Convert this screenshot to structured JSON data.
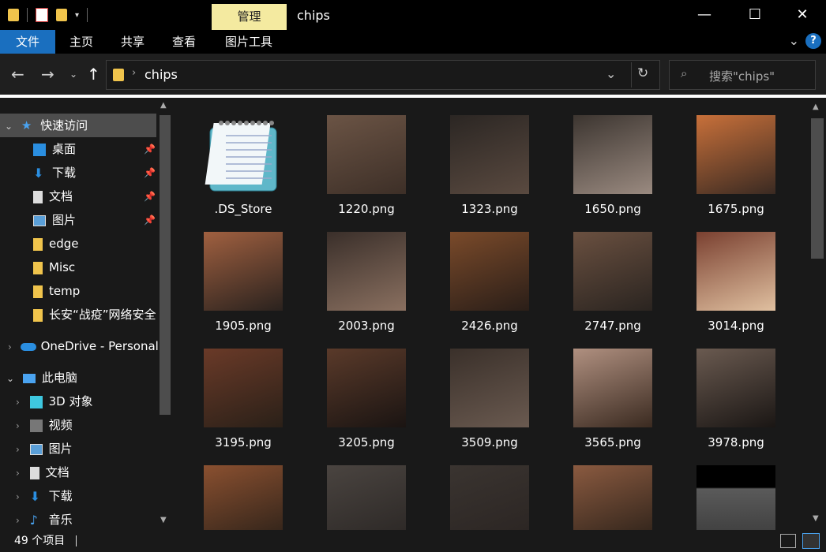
{
  "window": {
    "title": "chips",
    "manage_tab": "管理",
    "controls": {
      "minimize": "—",
      "maximize": "☐",
      "close": "✕"
    }
  },
  "ribbon": {
    "tabs": [
      "文件",
      "主页",
      "共享",
      "查看",
      "图片工具"
    ],
    "active_tab": "文件",
    "help": "?"
  },
  "address": {
    "path": "chips",
    "search_placeholder": "搜索\"chips\""
  },
  "nav": {
    "quick_access": "快速访问",
    "items": [
      {
        "label": "桌面",
        "icon": "desktop-icon",
        "pinned": true
      },
      {
        "label": "下载",
        "icon": "download-icon",
        "pinned": true
      },
      {
        "label": "文档",
        "icon": "document-icon",
        "pinned": true
      },
      {
        "label": "图片",
        "icon": "pictures-icon",
        "pinned": true
      },
      {
        "label": "edge",
        "icon": "folder-icon",
        "pinned": false
      },
      {
        "label": "Misc",
        "icon": "folder-icon",
        "pinned": false
      },
      {
        "label": "temp",
        "icon": "folder-icon",
        "pinned": false
      },
      {
        "label": "长安“战疫”网络安全",
        "icon": "folder-icon",
        "pinned": false
      }
    ],
    "onedrive": "OneDrive - Personal",
    "this_pc": "此电脑",
    "pc_items": [
      {
        "label": "3D 对象",
        "icon": "3d-objects-icon"
      },
      {
        "label": "视频",
        "icon": "videos-icon"
      },
      {
        "label": "图片",
        "icon": "pictures-icon"
      },
      {
        "label": "文档",
        "icon": "document-icon"
      },
      {
        "label": "下载",
        "icon": "download-icon"
      },
      {
        "label": "音乐",
        "icon": "music-icon"
      }
    ]
  },
  "files": [
    {
      "name": ".DS_Store",
      "kind": "notepad"
    },
    {
      "name": "1220.png",
      "kind": "photo"
    },
    {
      "name": "1323.png",
      "kind": "photo"
    },
    {
      "name": "1650.png",
      "kind": "photo"
    },
    {
      "name": "1675.png",
      "kind": "photo"
    },
    {
      "name": "1905.png",
      "kind": "photo"
    },
    {
      "name": "2003.png",
      "kind": "photo"
    },
    {
      "name": "2426.png",
      "kind": "photo"
    },
    {
      "name": "2747.png",
      "kind": "photo"
    },
    {
      "name": "3014.png",
      "kind": "photo"
    },
    {
      "name": "3195.png",
      "kind": "photo"
    },
    {
      "name": "3205.png",
      "kind": "photo"
    },
    {
      "name": "3509.png",
      "kind": "photo"
    },
    {
      "name": "3565.png",
      "kind": "photo"
    },
    {
      "name": "3978.png",
      "kind": "photo"
    },
    {
      "name": "",
      "kind": "photo"
    },
    {
      "name": "",
      "kind": "photo"
    },
    {
      "name": "",
      "kind": "photo"
    },
    {
      "name": "",
      "kind": "photo"
    },
    {
      "name": "",
      "kind": "photo-dark"
    }
  ],
  "status": {
    "count": "49 个项目"
  },
  "colors": {
    "accent": "#1a6fbf",
    "manage_tab": "#f4eaa0",
    "folder": "#f0c44c"
  }
}
